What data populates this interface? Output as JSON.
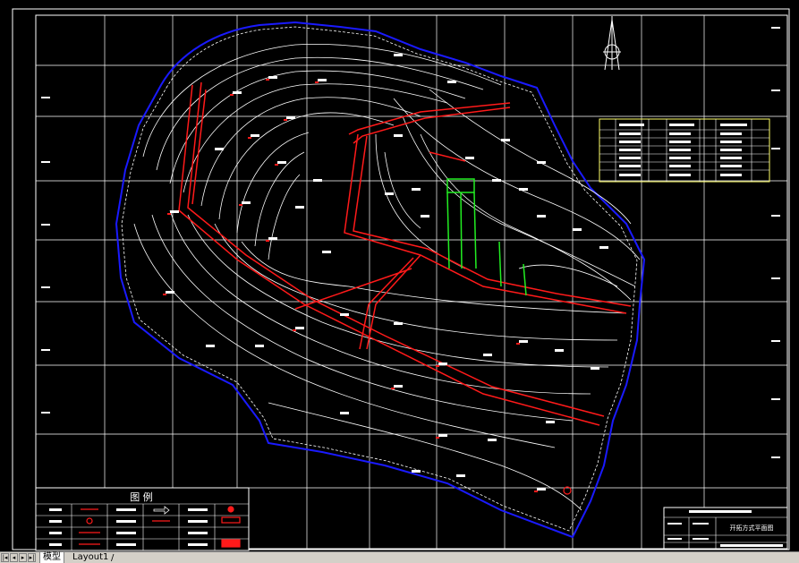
{
  "app": {
    "title": ""
  },
  "tabs": {
    "model_label": "模型",
    "layout1_label": "Layout1",
    "separator": "/"
  },
  "nav_icons": [
    "first-tab-icon",
    "prev-tab-icon",
    "next-tab-icon",
    "last-tab-icon"
  ],
  "drawing": {
    "legend_title": "图 例",
    "title_block_line1": "",
    "title_block_line2": "开拓方式平面图",
    "title_block_line3": "",
    "colors": {
      "background": "#000000",
      "grid": "#ffffff",
      "contour": "#ffffff",
      "boundary": "#1a1aff",
      "roadway": "#ff1a1a",
      "shaft": "#22ee22",
      "table_border": "#ffff66"
    }
  }
}
